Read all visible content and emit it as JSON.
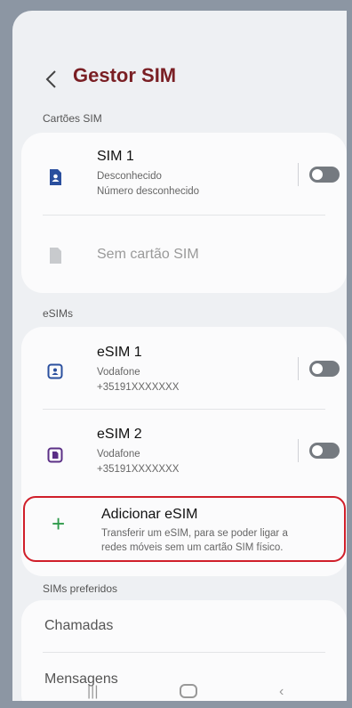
{
  "header": {
    "title": "Gestor SIM"
  },
  "sections": {
    "sim_cards": "Cartões SIM",
    "esims": "eSIMs",
    "preferred": "SIMs preferidos"
  },
  "sim_cards": [
    {
      "title": "SIM 1",
      "line1": "Desconhecido",
      "line2": "Número desconhecido"
    },
    {
      "title": "Sem cartão SIM"
    }
  ],
  "esims": [
    {
      "title": "eSIM 1",
      "line1": "Vodafone",
      "line2": "+35191XXXXXXX"
    },
    {
      "title": "eSIM 2",
      "line1": "Vodafone",
      "line2": "+35191XXXXXXX"
    }
  ],
  "add_esim": {
    "title": "Adicionar eSIM",
    "desc1": "Transferir um eSIM, para se poder ligar a",
    "desc2": "redes móveis sem um cartão SIM físico."
  },
  "preferred": [
    {
      "title": "Chamadas"
    },
    {
      "title": "Mensagens"
    }
  ],
  "colors": {
    "title": "#7a1f24",
    "sim_icon": "#2a4f9e",
    "esim2_icon": "#5b2f86",
    "highlight": "#d01f2a",
    "plus": "#2e9a4a"
  }
}
